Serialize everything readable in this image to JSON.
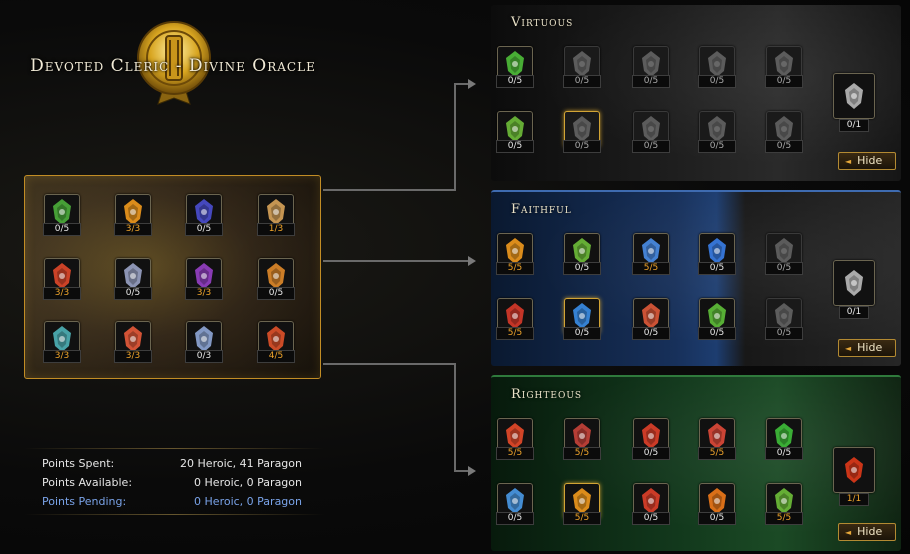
{
  "title": "Devoted Cleric - Divine Oracle",
  "core_tiles": [
    {
      "icon": "leaf-wing-icon",
      "value": "0/5",
      "color": "#4caf3b"
    },
    {
      "icon": "sun-icon",
      "value": "3/3",
      "color": "#f29a1d",
      "gold": true
    },
    {
      "icon": "winged-spire-icon",
      "value": "0/5",
      "color": "#4b4fd1"
    },
    {
      "icon": "praying-hands-icon",
      "value": "1/3",
      "color": "#d9a45a",
      "gold": true
    },
    {
      "icon": "red-gem-icon",
      "value": "3/3",
      "color": "#e0482a",
      "gold": true
    },
    {
      "icon": "robed-figure-icon",
      "value": "0/5",
      "color": "#9aa3c6"
    },
    {
      "icon": "purple-head-icon",
      "value": "3/3",
      "color": "#9740c7",
      "gold": true
    },
    {
      "icon": "hammer-icon",
      "value": "0/5",
      "color": "#e08a2a"
    },
    {
      "icon": "helm-icon",
      "value": "3/3",
      "color": "#4fb2b8",
      "gold": true
    },
    {
      "icon": "crossed-bones-icon",
      "value": "3/3",
      "color": "#e85b3b",
      "gold": true
    },
    {
      "icon": "spire-figure-icon",
      "value": "0/3",
      "color": "#8fa7d8"
    },
    {
      "icon": "red-cube-icon",
      "value": "4/5",
      "color": "#e0522a",
      "gold": true
    }
  ],
  "trees": [
    {
      "name": "Virtuous",
      "hide_label": "Hide",
      "tiles": [
        {
          "icon": "green-star-icon",
          "value": "0/5",
          "color": "#4fbf3a",
          "locked": false
        },
        {
          "icon": "cross-icon",
          "value": "0/5",
          "color": "#bbb",
          "locked": true
        },
        {
          "icon": "swirl-icon",
          "value": "0/5",
          "color": "#bbb",
          "locked": true
        },
        {
          "icon": "fist-icon",
          "value": "0/5",
          "color": "#bbb",
          "locked": true
        },
        {
          "icon": "leaf-icon",
          "value": "0/5",
          "color": "#bbb",
          "locked": true
        },
        {
          "icon": "green-shield-icon",
          "value": "0/5",
          "color": "#6fbe3a",
          "locked": false
        },
        {
          "icon": "eye-icon",
          "value": "0/5",
          "color": "#bbb",
          "locked": true,
          "selected": true
        },
        {
          "icon": "tree-icon",
          "value": "0/5",
          "color": "#bbb",
          "locked": true
        },
        {
          "icon": "praying-hands-icon",
          "value": "0/5",
          "color": "#bbb",
          "locked": true
        },
        {
          "icon": "flame-icon",
          "value": "0/5",
          "color": "#bbb",
          "locked": true
        }
      ],
      "capstone": {
        "icon": "shield-crest-icon",
        "value": "0/1",
        "color": "#bbb"
      }
    },
    {
      "name": "Faithful",
      "hide_label": "Hide",
      "tiles": [
        {
          "icon": "sun-icon",
          "value": "5/5",
          "color": "#f29a1d",
          "gold": true
        },
        {
          "icon": "wreath-icon",
          "value": "0/5",
          "color": "#6fbf3a"
        },
        {
          "icon": "blue-crystal-icon",
          "value": "5/5",
          "color": "#4a8ee8",
          "gold": true
        },
        {
          "icon": "blue-cross-icon",
          "value": "0/5",
          "color": "#3a7ee8"
        },
        {
          "icon": "dark-flower-icon",
          "value": "0/5",
          "color": "#bbb",
          "locked": true
        },
        {
          "icon": "blood-drop-icon",
          "value": "5/5",
          "color": "#d83a2a",
          "gold": true
        },
        {
          "icon": "blue-orb-icon",
          "value": "0/5",
          "color": "#3a8ee8",
          "selected": true
        },
        {
          "icon": "hourglass-icon",
          "value": "0/5",
          "color": "#e05a3a"
        },
        {
          "icon": "green-gauntlet-icon",
          "value": "0/5",
          "color": "#5fc03a"
        },
        {
          "icon": "grey-shield-icon",
          "value": "0/5",
          "color": "#bbb",
          "locked": true
        }
      ],
      "capstone": {
        "icon": "dark-gem-icon",
        "value": "0/1",
        "color": "#bbb"
      }
    },
    {
      "name": "Righteous",
      "hide_label": "Hide",
      "tiles": [
        {
          "icon": "vortex-icon",
          "value": "5/5",
          "color": "#e84a2a",
          "gold": true
        },
        {
          "icon": "red-shield-icon",
          "value": "5/5",
          "color": "#c8423a",
          "gold": true
        },
        {
          "icon": "red-flame-icon",
          "value": "0/5",
          "color": "#e0402a"
        },
        {
          "icon": "red-banner-icon",
          "value": "5/5",
          "color": "#e04a3a",
          "gold": true
        },
        {
          "icon": "green-hood-icon",
          "value": "0/5",
          "color": "#3fbf3a"
        },
        {
          "icon": "ice-crystal-icon",
          "value": "0/5",
          "color": "#4a9ae8"
        },
        {
          "icon": "sunburst-icon",
          "value": "5/5",
          "color": "#f29a1d",
          "gold": true,
          "selected": true
        },
        {
          "icon": "red-tower-icon",
          "value": "0/5",
          "color": "#e0402a"
        },
        {
          "icon": "fire-burst-icon",
          "value": "0/5",
          "color": "#f07a1a"
        },
        {
          "icon": "green-staff-icon",
          "value": "5/5",
          "color": "#6fc03a",
          "gold": true
        }
      ],
      "capstone": {
        "icon": "inferno-icon",
        "value": "1/1",
        "color": "#e03a1a",
        "gold": true
      }
    }
  ],
  "stats": {
    "spent_label": "Points Spent:",
    "spent_value": "20 Heroic, 41 Paragon",
    "available_label": "Points Available:",
    "available_value": "0 Heroic, 0 Paragon",
    "pending_label": "Points Pending:",
    "pending_value": "0 Heroic, 0 Paragon"
  }
}
